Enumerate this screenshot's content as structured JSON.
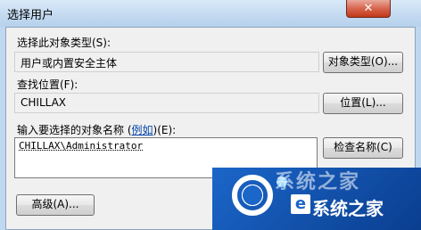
{
  "window": {
    "title": "选择用户",
    "close_label": "✕"
  },
  "object_type": {
    "label": "选择此对象类型(S):",
    "value": "用户或内置安全主体",
    "button_label": "对象类型(O)..."
  },
  "location": {
    "label": "查找位置(F):",
    "value": "CHILLAX",
    "button_label": "位置(L)..."
  },
  "names": {
    "label_prefix": "输入要选择的对象名称 (",
    "example_link": "例如",
    "label_suffix": ")(E):",
    "value": "CHILLAX\\Administrator",
    "check_button_label": "检查名称(C)"
  },
  "advanced": {
    "button_label": "高级(A)..."
  },
  "watermark": {
    "faint_text": "系统之家",
    "text": "系统之家",
    "logo_char": "e",
    "brand_color": "#1b66c9"
  }
}
